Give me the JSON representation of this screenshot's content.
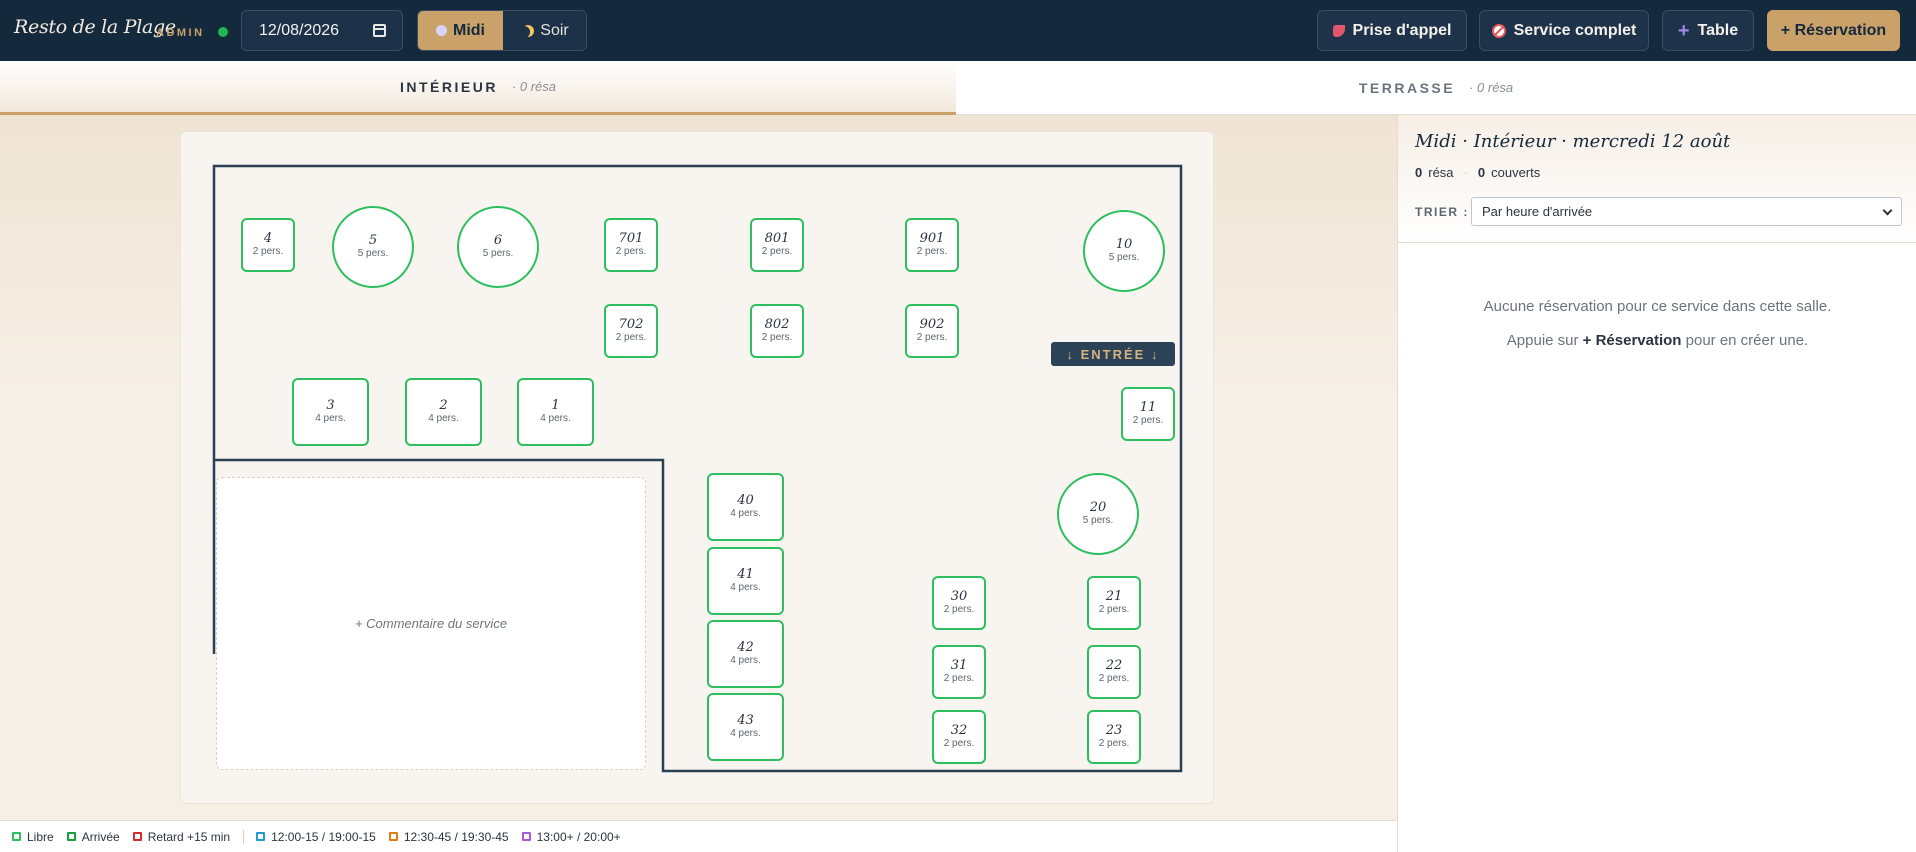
{
  "header": {
    "brand": "Resto de la Plage",
    "role_badge": "ADMIN",
    "date_value": "12/08/2026",
    "services": [
      {
        "label": "Midi",
        "icon": "sun-icon",
        "active": true
      },
      {
        "label": "Soir",
        "icon": "moon-icon",
        "active": false
      }
    ],
    "actions": {
      "call": "Prise d'appel",
      "full": "Service complet",
      "table": "Table",
      "reservation": "+ Réservation"
    }
  },
  "rooms": [
    {
      "name": "INTÉRIEUR",
      "count": "· 0 résa",
      "active": true
    },
    {
      "name": "TERRASSE",
      "count": "· 0 résa",
      "active": false
    }
  ],
  "floor": {
    "entrance_label": "↓ ENTRÉE ↓",
    "comment_placeholder": "+ Commentaire du service",
    "tables": [
      {
        "num": "4",
        "cap": "2 pers.",
        "shape": "square",
        "status": "libre"
      },
      {
        "num": "5",
        "cap": "5 pers.",
        "shape": "round",
        "status": "libre"
      },
      {
        "num": "6",
        "cap": "5 pers.",
        "shape": "round",
        "status": "libre"
      },
      {
        "num": "701",
        "cap": "2 pers.",
        "shape": "square",
        "status": "libre"
      },
      {
        "num": "801",
        "cap": "2 pers.",
        "shape": "square",
        "status": "libre"
      },
      {
        "num": "901",
        "cap": "2 pers.",
        "shape": "square",
        "status": "libre"
      },
      {
        "num": "10",
        "cap": "5 pers.",
        "shape": "round",
        "status": "libre"
      },
      {
        "num": "702",
        "cap": "2 pers.",
        "shape": "square",
        "status": "libre"
      },
      {
        "num": "802",
        "cap": "2 pers.",
        "shape": "square",
        "status": "libre"
      },
      {
        "num": "902",
        "cap": "2 pers.",
        "shape": "square",
        "status": "libre"
      },
      {
        "num": "3",
        "cap": "4 pers.",
        "shape": "square",
        "status": "libre"
      },
      {
        "num": "2",
        "cap": "4 pers.",
        "shape": "square",
        "status": "libre"
      },
      {
        "num": "1",
        "cap": "4 pers.",
        "shape": "square",
        "status": "libre"
      },
      {
        "num": "11",
        "cap": "2 pers.",
        "shape": "square",
        "status": "libre"
      },
      {
        "num": "40",
        "cap": "4 pers.",
        "shape": "square",
        "status": "libre"
      },
      {
        "num": "20",
        "cap": "5 pers.",
        "shape": "round",
        "status": "libre"
      },
      {
        "num": "41",
        "cap": "4 pers.",
        "shape": "square",
        "status": "libre"
      },
      {
        "num": "30",
        "cap": "2 pers.",
        "shape": "square",
        "status": "libre"
      },
      {
        "num": "21",
        "cap": "2 pers.",
        "shape": "square",
        "status": "libre"
      },
      {
        "num": "42",
        "cap": "4 pers.",
        "shape": "square",
        "status": "libre"
      },
      {
        "num": "31",
        "cap": "2 pers.",
        "shape": "square",
        "status": "libre"
      },
      {
        "num": "22",
        "cap": "2 pers.",
        "shape": "square",
        "status": "libre"
      },
      {
        "num": "43",
        "cap": "4 pers.",
        "shape": "square",
        "status": "libre"
      },
      {
        "num": "32",
        "cap": "2 pers.",
        "shape": "square",
        "status": "libre"
      },
      {
        "num": "23",
        "cap": "2 pers.",
        "shape": "square",
        "status": "libre"
      }
    ]
  },
  "panel": {
    "title": "Midi · Intérieur · mercredi 12 août",
    "resa_count": "0",
    "resa_label": "résa",
    "separator": "·",
    "covers_count": "0",
    "covers_label": "couverts",
    "sort_label": "TRIER :",
    "sort_value": "Par heure d'arrivée",
    "empty_line1": "Aucune réservation pour ce service dans cette salle.",
    "empty_prefix": "Appuie sur",
    "empty_action": "+ Réservation",
    "empty_suffix": "pour en créer une."
  },
  "legend": [
    {
      "label": "Libre",
      "color": "#2dbf5e"
    },
    {
      "label": "Arrivée",
      "color": "#1a9e3f"
    },
    {
      "label": "Retard +15 min",
      "color": "#d22c2c"
    },
    {
      "label": "12:00-15 / 19:00-15",
      "color": "#1d9ad6"
    },
    {
      "label": "12:30-45 / 19:30-45",
      "color": "#e07d10"
    },
    {
      "label": "13:00+ / 20:00+",
      "color": "#a55ad8"
    }
  ]
}
